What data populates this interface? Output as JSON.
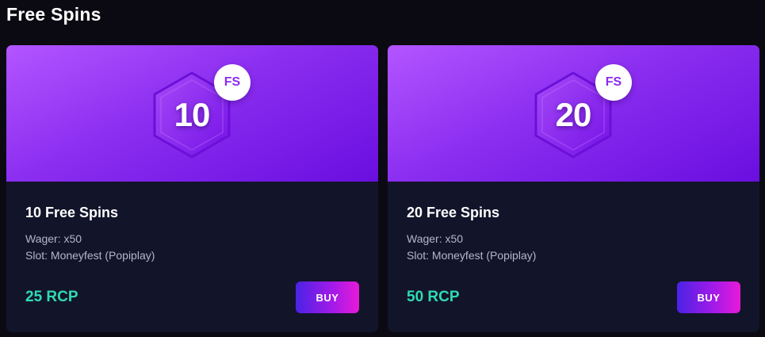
{
  "page": {
    "title": "Free Spins"
  },
  "colors": {
    "background": "#0b0a12",
    "card": "#12142a",
    "banner_gradient_start": "#b355ff",
    "banner_gradient_end": "#6a0ee0",
    "price": "#2fdbb0",
    "buy_gradient_start": "#4b22e6",
    "buy_gradient_end": "#e81ad8",
    "detail_text": "#b4b7c6"
  },
  "cards": [
    {
      "badge_number": "10",
      "badge_label": "FS",
      "badge_icon": "hexagon-icon",
      "title": "10 Free Spins",
      "wager": "Wager: x50",
      "slot": "Slot: Moneyfest (Popiplay)",
      "price": "25 RCP",
      "buy_label": "BUY"
    },
    {
      "badge_number": "20",
      "badge_label": "FS",
      "badge_icon": "hexagon-icon",
      "title": "20 Free Spins",
      "wager": "Wager: x50",
      "slot": "Slot: Moneyfest (Popiplay)",
      "price": "50 RCP",
      "buy_label": "BUY"
    }
  ]
}
